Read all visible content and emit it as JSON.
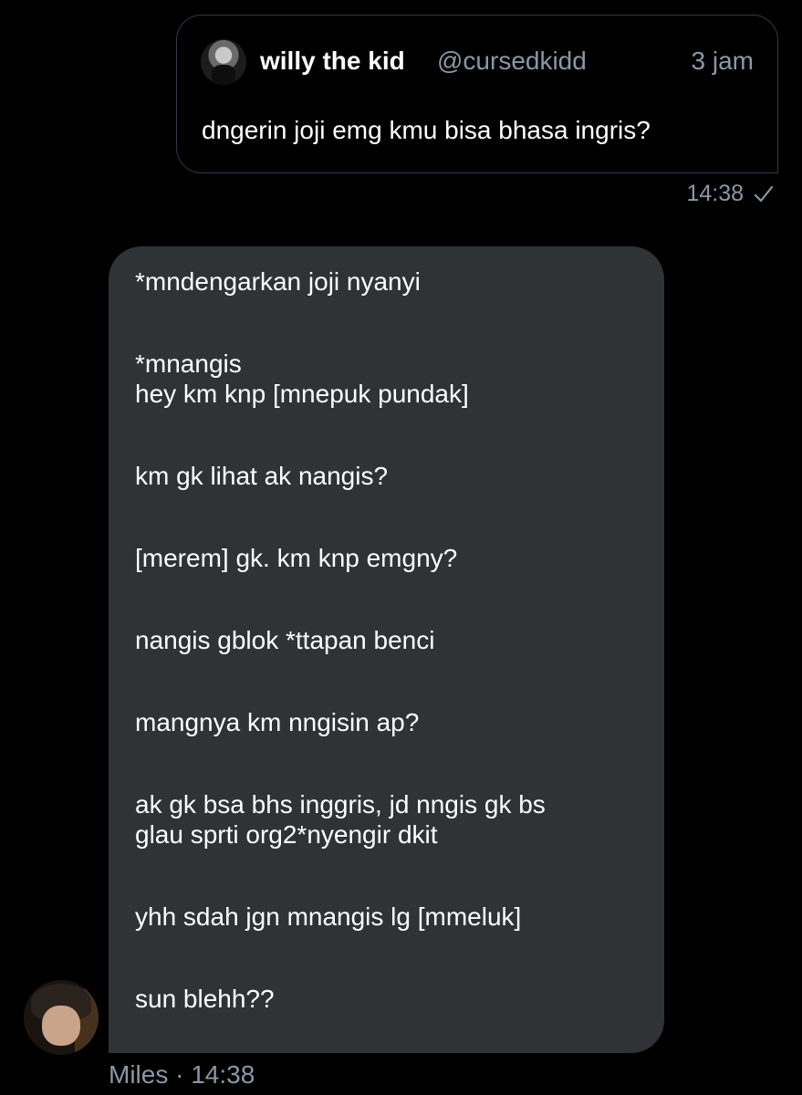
{
  "quoted_tweet": {
    "avatar_icon": "profile-photo-icon",
    "display_name": "willy the kid",
    "handle": "@cursedkidd",
    "time": "3 jam",
    "text": "dngerin joji emg kmu bisa bhasa ingris?"
  },
  "sent_message": {
    "time": "14:38",
    "status_icon": "check-icon"
  },
  "received_message": {
    "lines": [
      "*mndengarkan joji nyanyi",
      "",
      "*mnangis",
      "hey km knp [mnepuk pundak]",
      "",
      "km gk lihat ak nangis?",
      "",
      "[merem] gk. km knp emgny?",
      "",
      "nangis gblok *ttapan benci",
      "",
      "mangnya km nngisin ap?",
      "",
      "ak gk bsa bhs inggris, jd nngis gk bs",
      "glau sprti org2*nyengir dkit",
      "",
      "yhh sdah jgn mnangis lg [mmeluk]",
      "",
      "sun blehh??"
    ],
    "sender_name": "Miles",
    "separator": "·",
    "time": "14:38"
  },
  "colors": {
    "background": "#000000",
    "bubble": "#2f3336",
    "border": "#2f3d4a",
    "muted_text": "#8b98a5",
    "text": "#ffffff"
  }
}
